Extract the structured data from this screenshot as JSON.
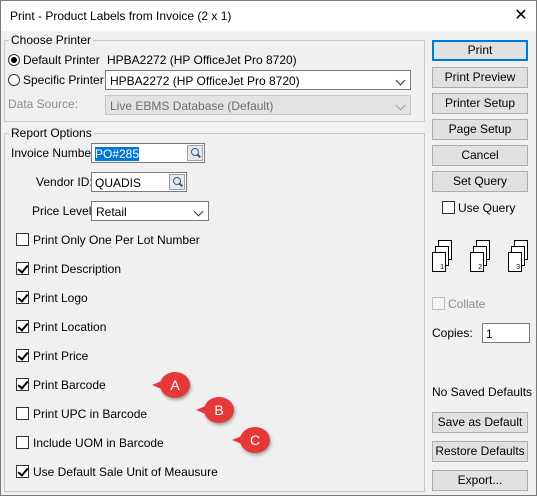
{
  "window": {
    "title": "Print - Product Labels from Invoice (2 x 1)",
    "close_glyph": "✕"
  },
  "choose_printer": {
    "group_label": "Choose Printer",
    "default_label": "Default Printer",
    "default_value": "HPBA2272 (HP OfficeJet Pro 8720)",
    "specific_label": "Specific Printer",
    "specific_value": "HPBA2272 (HP OfficeJet Pro 8720)",
    "data_source_label": "Data Source:",
    "data_source_value": "Live EBMS Database (Default)"
  },
  "report_options": {
    "group_label": "Report Options",
    "invoice_label": "Invoice Number:",
    "invoice_value": "PO#285",
    "vendor_label": "Vendor ID:",
    "vendor_value": "QUADIS",
    "price_label": "Price Level:",
    "price_value": "Retail",
    "checkboxes": [
      {
        "label": "Print Only One Per Lot Number",
        "checked": false
      },
      {
        "label": "Print Description",
        "checked": true
      },
      {
        "label": "Print Logo",
        "checked": true
      },
      {
        "label": "Print Location",
        "checked": true
      },
      {
        "label": "Print Price",
        "checked": true
      },
      {
        "label": "Print Barcode",
        "checked": true
      },
      {
        "label": "Print UPC in Barcode",
        "checked": false
      },
      {
        "label": "Include UOM in Barcode",
        "checked": false
      },
      {
        "label": "Use Default Sale Unit of Meausure",
        "checked": true
      }
    ]
  },
  "buttons": {
    "print": "Print",
    "print_preview": "Print Preview",
    "printer_setup": "Printer Setup",
    "page_setup": "Page Setup",
    "cancel": "Cancel",
    "set_query": "Set Query",
    "save_defaults": "Save as Default",
    "restore_defaults": "Restore Defaults",
    "export": "Export..."
  },
  "right_panel": {
    "use_query_label": "Use Query",
    "collate_label": "Collate",
    "collate_pages": [
      "1",
      "2",
      "3"
    ],
    "copies_label": "Copies:",
    "copies_value": "1",
    "saved_defaults_text": "No Saved Defaults"
  },
  "callouts": [
    "A",
    "B",
    "C"
  ],
  "colors": {
    "accent": "#0078d7",
    "callout": "#e53838"
  }
}
